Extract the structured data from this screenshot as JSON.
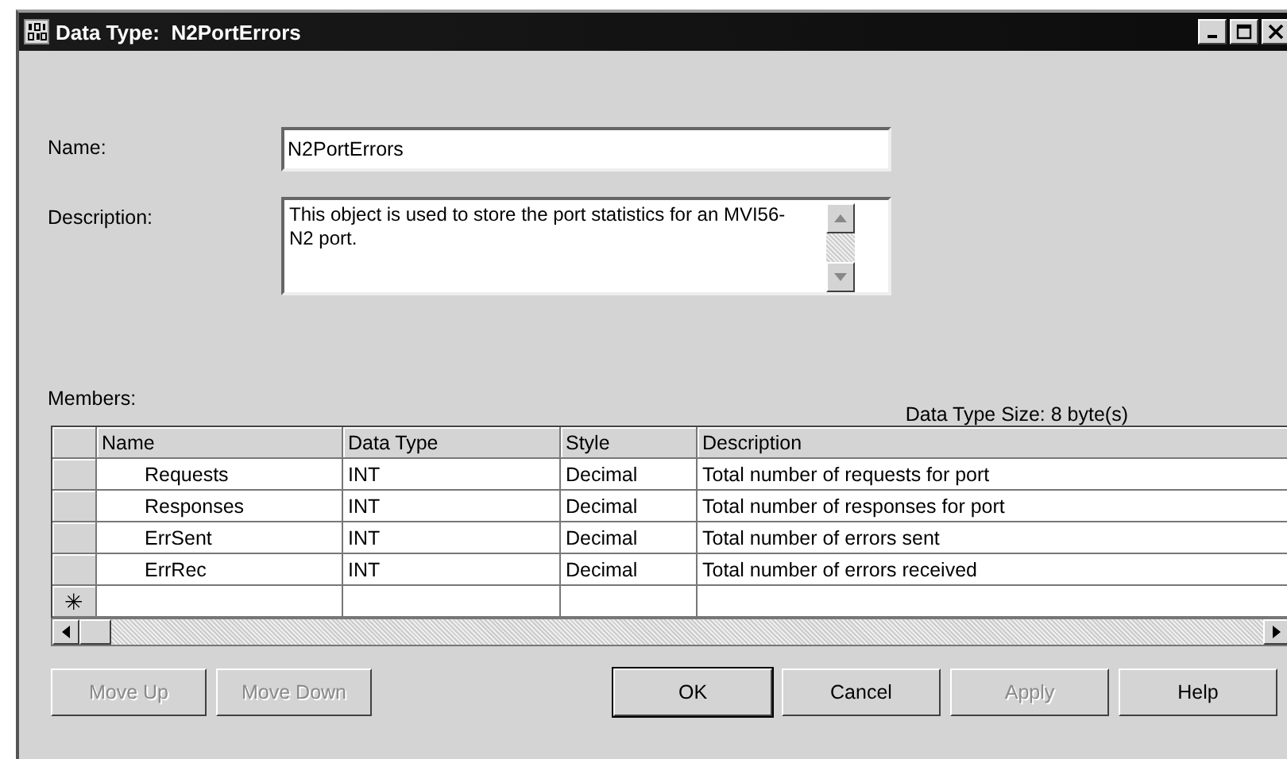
{
  "window": {
    "title": "Data Type:  N2PortErrors"
  },
  "name": {
    "label": "Name:",
    "value": "N2PortErrors"
  },
  "description": {
    "label": "Description:",
    "value": "This object is used to store the port statistics for an MVI56-N2 port."
  },
  "members": {
    "label": "Members:",
    "size": "Data Type Size: 8 byte(s)"
  },
  "table": {
    "columns": [
      "Name",
      "Data Type",
      "Style",
      "Description"
    ],
    "rows": [
      [
        "Requests",
        "INT",
        "Decimal",
        "Total number of requests for port"
      ],
      [
        "Responses",
        "INT",
        "Decimal",
        "Total number of responses for port"
      ],
      [
        "ErrSent",
        "INT",
        "Decimal",
        "Total number of errors sent"
      ],
      [
        "ErrRec",
        "INT",
        "Decimal",
        "Total number of errors received"
      ]
    ],
    "new_row_marker": "✳"
  },
  "buttons": [
    {
      "label": "Move Up",
      "disabled": true,
      "default": false
    },
    {
      "label": "Move Down",
      "disabled": true,
      "default": false
    },
    {
      "label": "OK",
      "disabled": false,
      "default": true
    },
    {
      "label": "Cancel",
      "disabled": false,
      "default": false
    },
    {
      "label": "Apply",
      "disabled": true,
      "default": false
    },
    {
      "label": "Help",
      "disabled": false,
      "default": false
    }
  ]
}
